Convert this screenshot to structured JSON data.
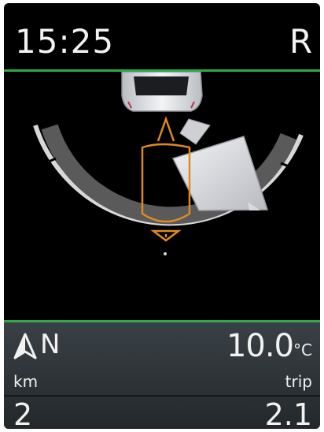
{
  "header": {
    "time": "15:25",
    "gear": "R"
  },
  "scene": {
    "guideline_color": "#e08a1e",
    "obstacle_color": "#d9dadf",
    "arc_color": "#bdbdbd"
  },
  "status": {
    "compass_icon": "north-arrow-icon",
    "heading": "N",
    "temperature": "10.0",
    "temperature_unit": "°C",
    "odometer_label": "km",
    "odometer_value": "2",
    "trip_label": "trip",
    "trip_value": "2.1"
  },
  "colors": {
    "accent_green": "#2fa84a",
    "background": "#000000",
    "panel": "#2c3236",
    "text": "#f2f2f2"
  }
}
